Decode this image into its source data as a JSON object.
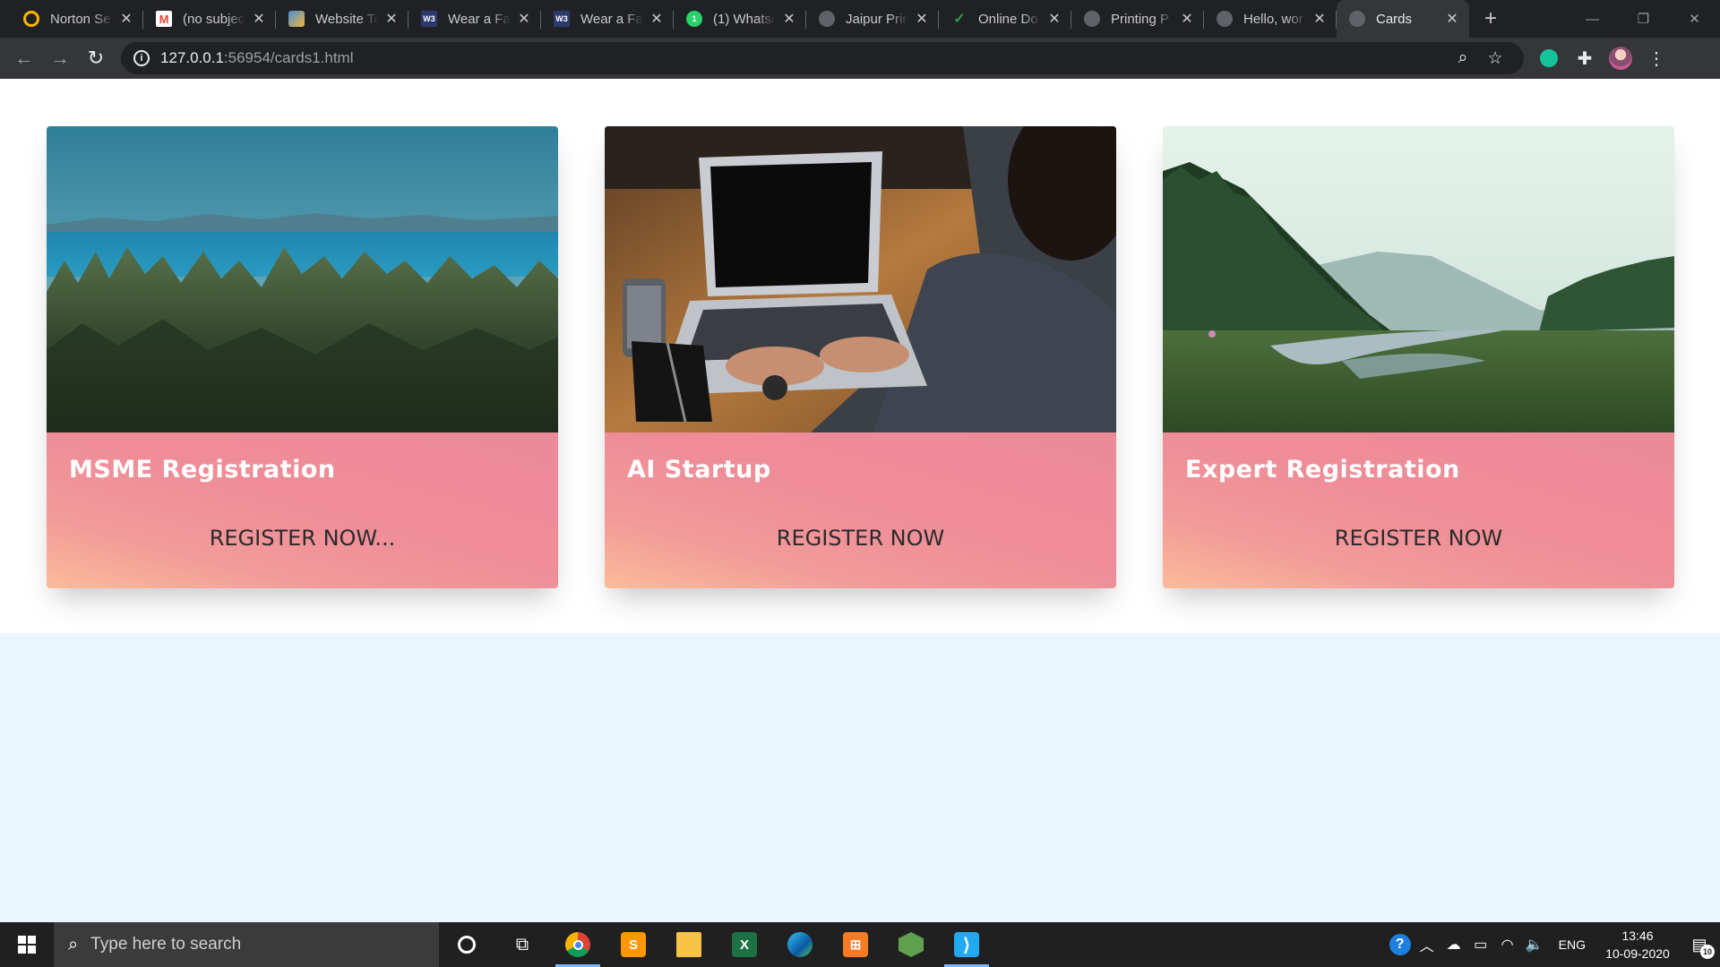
{
  "browser": {
    "tabs": [
      {
        "title": "Norton Se",
        "icon": "norton-icon",
        "color": "#f8b600"
      },
      {
        "title": "(no subjec",
        "icon": "gmail-icon",
        "color": "#ea4335"
      },
      {
        "title": "Website Te",
        "icon": "website-icon",
        "color": "#4a8fd6"
      },
      {
        "title": "Wear a Fa",
        "icon": "w3schools-icon",
        "color": "#2c3a6b"
      },
      {
        "title": "Wear a Fa",
        "icon": "w3schools-icon",
        "color": "#2c3a6b"
      },
      {
        "title": "(1) Whats/",
        "icon": "whatsapp-icon",
        "color": "#25d366"
      },
      {
        "title": "Jaipur Prin",
        "icon": "globe-icon",
        "color": "#5f6368"
      },
      {
        "title": "Online Do",
        "icon": "online-doc-icon",
        "color": "#2e9b4f"
      },
      {
        "title": "Printing P",
        "icon": "globe-icon",
        "color": "#5f6368"
      },
      {
        "title": "Hello, wor",
        "icon": "globe-icon",
        "color": "#5f6368"
      },
      {
        "title": "Cards",
        "icon": "globe-icon",
        "color": "#5f6368",
        "active": true
      }
    ],
    "new_tab": "+",
    "url_host": "127.0.0.1",
    "url_rest": ":56954/cards1.html"
  },
  "cards": [
    {
      "title": "MSME Registration",
      "button": "REGISTER NOW...",
      "image": "forest-lake-photo"
    },
    {
      "title": "AI Startup",
      "button": "REGISTER NOW",
      "image": "laptop-photo"
    },
    {
      "title": "Expert Registration",
      "button": "REGISTER NOW",
      "image": "valley-river-photo"
    }
  ],
  "taskbar": {
    "search_placeholder": "Type here to search",
    "apps": [
      "cortana",
      "task-view",
      "chrome",
      "sublime-text",
      "file-explorer",
      "excel",
      "edge",
      "xampp",
      "node",
      "vscode"
    ],
    "language": "ENG",
    "time": "13:46",
    "date": "10-09-2020",
    "notifications": "10"
  }
}
